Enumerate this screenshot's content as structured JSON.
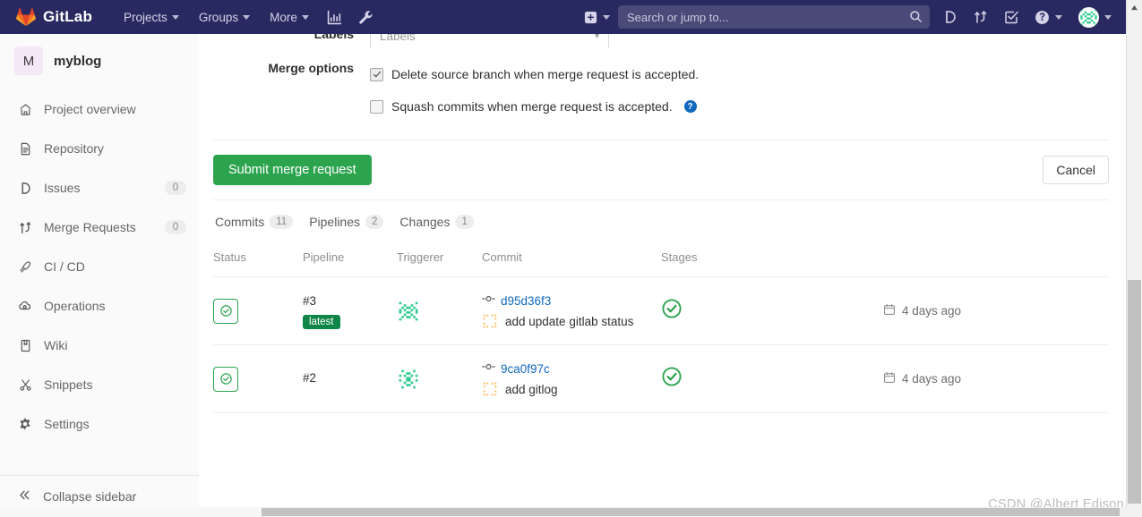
{
  "navbar": {
    "brand": "GitLab",
    "links": [
      {
        "label": "Projects",
        "has_caret": true
      },
      {
        "label": "Groups",
        "has_caret": true
      },
      {
        "label": "More",
        "has_caret": true
      }
    ],
    "left_icons": [
      {
        "name": "analytics-chart-icon"
      },
      {
        "name": "wrench-icon"
      }
    ],
    "create_new": {
      "name": "plus-square-icon",
      "has_caret": true
    },
    "search": {
      "placeholder": "Search or jump to...",
      "value": ""
    },
    "right_icons": [
      {
        "name": "issues-icon"
      },
      {
        "name": "merge-requests-icon"
      },
      {
        "name": "todos-checkbox-icon"
      },
      {
        "name": "help-question-icon",
        "has_caret": true
      }
    ],
    "user_menu": {
      "name": "user-avatar",
      "has_caret": true
    }
  },
  "sidebar": {
    "project": {
      "initial": "M",
      "name": "myblog"
    },
    "items": [
      {
        "label": "Project overview",
        "icon": "home-icon",
        "badge": ""
      },
      {
        "label": "Repository",
        "icon": "document-icon",
        "badge": ""
      },
      {
        "label": "Issues",
        "icon": "issues-icon",
        "badge": "0"
      },
      {
        "label": "Merge Requests",
        "icon": "merge-requests-icon",
        "badge": "0"
      },
      {
        "label": "CI / CD",
        "icon": "rocket-icon",
        "badge": ""
      },
      {
        "label": "Operations",
        "icon": "cloud-gear-icon",
        "badge": ""
      },
      {
        "label": "Wiki",
        "icon": "book-icon",
        "badge": ""
      },
      {
        "label": "Snippets",
        "icon": "scissors-icon",
        "badge": ""
      },
      {
        "label": "Settings",
        "icon": "gear-icon",
        "badge": ""
      }
    ],
    "collapse": {
      "label": "Collapse sidebar",
      "icon": "chevron-double-left-icon"
    }
  },
  "form": {
    "labels_field": {
      "label": "Labels",
      "placeholder": "Labels",
      "value": ""
    },
    "merge_options": {
      "label": "Merge options",
      "options": [
        {
          "text": "Delete source branch when merge request is accepted.",
          "checked": true,
          "help": false
        },
        {
          "text": "Squash commits when merge request is accepted.",
          "checked": false,
          "help": true
        }
      ]
    },
    "submit_label": "Submit merge request",
    "cancel_label": "Cancel"
  },
  "tabs": [
    {
      "label": "Commits",
      "count": "11"
    },
    {
      "label": "Pipelines",
      "count": "2"
    },
    {
      "label": "Changes",
      "count": "1"
    }
  ],
  "pipelines": {
    "columns": [
      "Status",
      "Pipeline",
      "Triggerer",
      "Commit",
      "Stages",
      ""
    ],
    "rows": [
      {
        "status_icon": "status-passed-icon",
        "pipeline_id": "#3",
        "badge": "latest",
        "triggerer_avatar": "identicon-green",
        "commit_sha": "d95d36f3",
        "commit_title": "add update gitlab status",
        "commit_avatar": "identicon-orange",
        "stage_icon": "stage-passed-icon",
        "time": "4 days ago"
      },
      {
        "status_icon": "status-passed-icon",
        "pipeline_id": "#2",
        "badge": "",
        "triggerer_avatar": "identicon-green",
        "commit_sha": "9ca0f97c",
        "commit_title": "add gitlog",
        "commit_avatar": "identicon-orange",
        "stage_icon": "stage-passed-icon",
        "time": "4 days ago"
      }
    ]
  },
  "watermark": "CSDN @Albert Edison",
  "colors": {
    "navbar_bg": "#292961",
    "accent_green": "#2ca44e",
    "badge_green": "#108548",
    "link_blue": "#1068bf",
    "help_blue": "#1068bf",
    "sidebar_bg": "#fafafa"
  }
}
